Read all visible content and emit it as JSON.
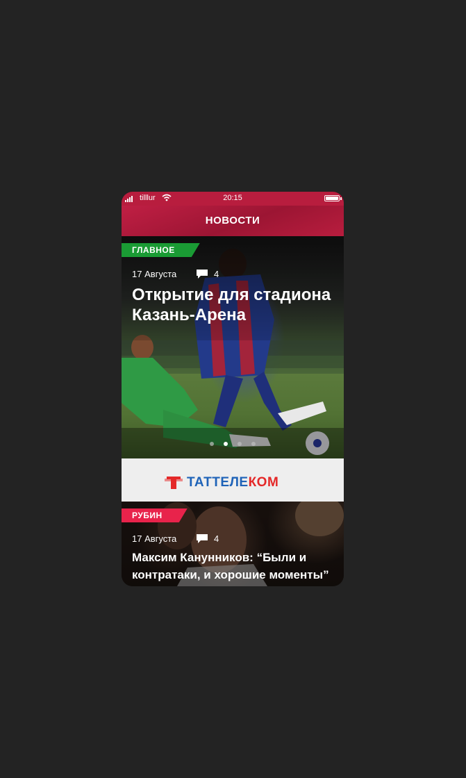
{
  "status_bar": {
    "carrier": "tilllur",
    "time": "20:15"
  },
  "header": {
    "title": "НОВОСТИ"
  },
  "featured": {
    "category": "ГЛАВНОЕ",
    "date": "17 Августа",
    "comments": "4",
    "headline": "Открытие для стадиона Казань-Арена",
    "carousel": {
      "total": 4,
      "active_index": 1
    }
  },
  "ad_banner": {
    "brand_part1": "ТАТТЕЛЕ",
    "brand_part2": "КОМ",
    "brand_color_primary": "#1e63b8",
    "brand_color_accent": "#e42828"
  },
  "news_items": [
    {
      "category": "РУБИН",
      "date": "17 Августа",
      "comments": "4",
      "headline": "Максим Канунников: “Были и контратаки, и хорошие моменты”"
    }
  ],
  "colors": {
    "brand_red": "#b81d3e",
    "badge_green": "#1a9b34",
    "badge_red": "#e8234b",
    "page_bg": "#232323"
  },
  "icons": [
    "signal-icon",
    "wifi-icon",
    "battery-icon",
    "comment-icon",
    "tattelecom-logo-icon"
  ]
}
